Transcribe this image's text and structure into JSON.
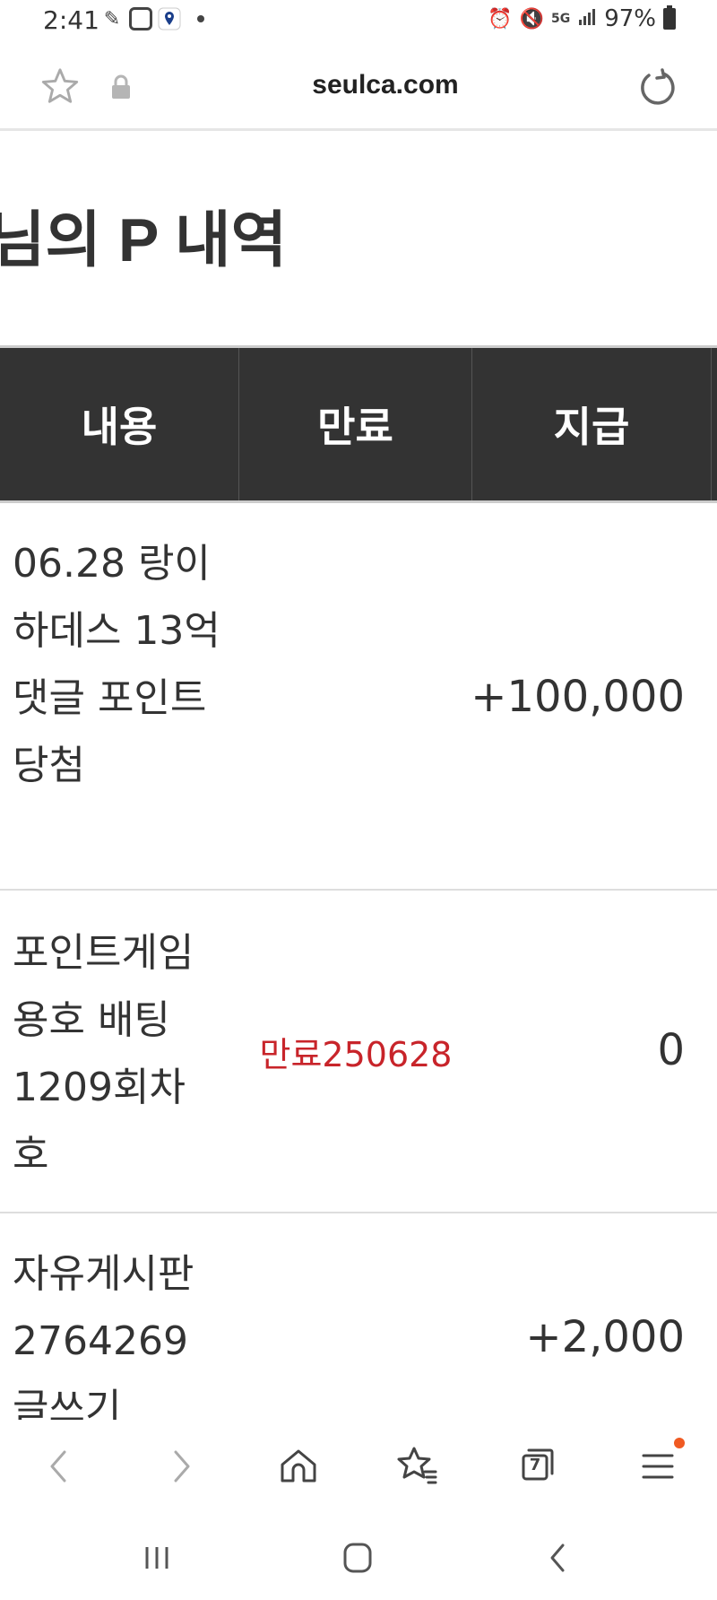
{
  "status_bar": {
    "time": "2:41",
    "battery": "97%",
    "network": "5G",
    "icons": [
      "feather-icon",
      "app-badge-icon",
      "location-pin-icon",
      "alarm-icon",
      "mute-icon",
      "signal-icon",
      "battery-icon"
    ]
  },
  "browser": {
    "url": "seulca.com"
  },
  "page": {
    "title": "님의 P 내역"
  },
  "table": {
    "headers": [
      "내용",
      "만료",
      "지급"
    ],
    "rows": [
      {
        "content": "06.28 랑이 하데스 13억 댓글 포인트 당첨",
        "expire": "",
        "amount": "+100,000"
      },
      {
        "content": "포인트게임 용호 배팅 1209회차 호",
        "expire": "만료250628",
        "amount": "0"
      },
      {
        "content": "자유게시판 2764269 글쓰기",
        "expire": "",
        "amount": "+2,000"
      }
    ]
  },
  "bottom_nav": {
    "tab_count": "7",
    "items": [
      "back-icon",
      "forward-icon",
      "home-icon",
      "bookmarks-icon",
      "tabs-icon",
      "menu-icon"
    ]
  },
  "colors": {
    "header_bg": "#333333",
    "expire_text": "#c8242a",
    "badge": "#f05a22"
  }
}
